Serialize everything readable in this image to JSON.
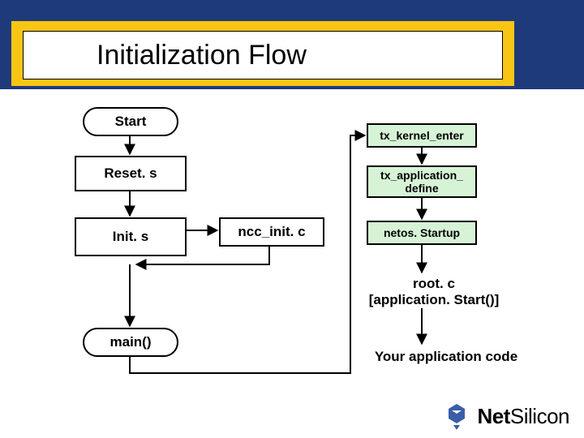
{
  "title": "Initialization Flow",
  "nodes": {
    "start": {
      "label": "Start"
    },
    "reset": {
      "label": "Reset. s"
    },
    "init": {
      "label": "Init. s"
    },
    "ncc_init": {
      "label": "ncc_init. c"
    },
    "main": {
      "label": "main()"
    },
    "tx_kernel_enter": {
      "label": "tx_kernel_enter"
    },
    "tx_app_define": {
      "label": "tx_application_\ndefine"
    },
    "netos_startup": {
      "label": "netos. Startup"
    }
  },
  "captions": {
    "root": "root. c\n[application. Start()]",
    "app_code": "Your application code"
  },
  "logo": {
    "net": "Net",
    "silicon": "Silicon"
  },
  "colors": {
    "header_blue": "#1f3a7a",
    "header_yellow": "#f9c515",
    "green": "#d6f3d6"
  }
}
